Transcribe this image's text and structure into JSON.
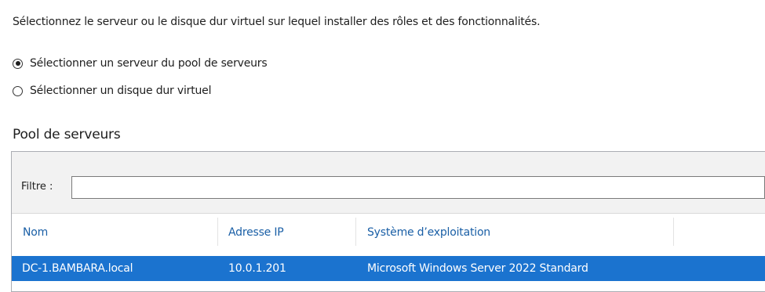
{
  "instruction": "Sélectionnez le serveur ou le disque dur virtuel sur lequel installer des rôles et des fonctionnalités.",
  "options": [
    {
      "label": "Sélectionner un serveur du pool de serveurs",
      "selected": true
    },
    {
      "label": "Sélectionner un disque dur virtuel",
      "selected": false
    }
  ],
  "pool": {
    "title": "Pool de serveurs",
    "filter": {
      "label": "Filtre :",
      "value": ""
    },
    "columns": [
      "Nom",
      "Adresse IP",
      "Système d’exploitation"
    ],
    "rows": [
      {
        "name": "DC-1.BAMBARA.local",
        "ip": "10.0.1.201",
        "os": "Microsoft Windows Server 2022 Standard",
        "selected": true
      }
    ]
  },
  "colors": {
    "header_text": "#1a5fa6",
    "selection": "#1b73cf"
  }
}
